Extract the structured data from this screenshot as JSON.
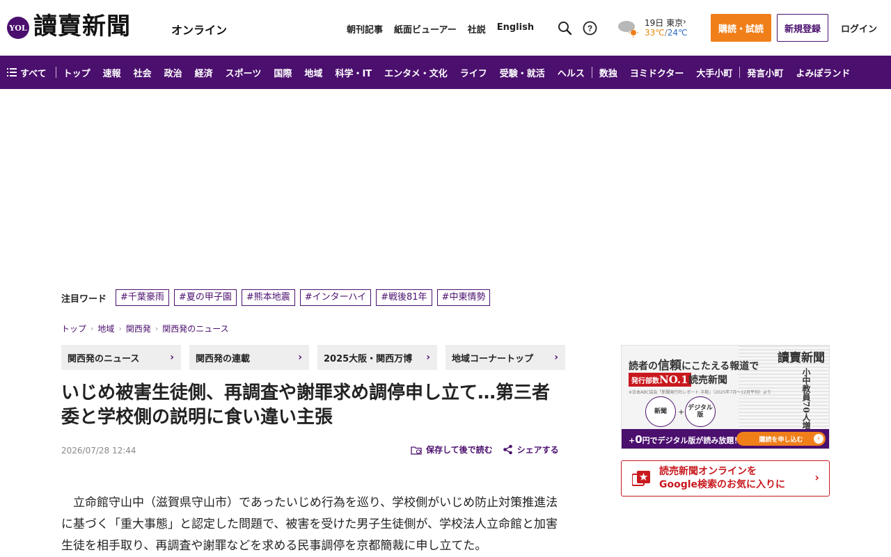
{
  "header": {
    "logo_badge": "YOL",
    "logo_title": "讀賣新聞",
    "logo_sub": "オンライン",
    "links": [
      "朝刊記事",
      "紙面ビューアー",
      "社説",
      "English"
    ],
    "weather": {
      "date": "19日 東京",
      "high": "33℃",
      "low": "24℃"
    },
    "subscribe_label": "購読・試読",
    "register_label": "新規登録",
    "login_label": "ログイン",
    "accent_color": "#4b0f6e",
    "orange_color": "#f07f1a"
  },
  "nav": {
    "all_label": "すべて",
    "items_a": [
      "トップ",
      "速報",
      "社会",
      "政治",
      "経済",
      "スポーツ",
      "国際",
      "地域",
      "科学・IT",
      "エンタメ・文化",
      "ライフ",
      "受験・就活",
      "ヘルス"
    ],
    "items_b": [
      "数独",
      "ヨミドクター",
      "大手小町"
    ],
    "items_c": [
      "発言小町",
      "よみぽランド"
    ]
  },
  "trend": {
    "label": "注目ワード",
    "tags": [
      "#千葉豪雨",
      "#夏の甲子園",
      "#熊本地震",
      "#インターハイ",
      "#戦後81年",
      "#中東情勢"
    ]
  },
  "breadcrumb": [
    "トップ",
    "地域",
    "関西発",
    "関西発のニュース"
  ],
  "subnav": [
    "関西発のニュース",
    "関西発の連載",
    "2025大阪・関西万博",
    "地域コーナートップ"
  ],
  "article": {
    "headline": "いじめ被害生徒側、再調査や謝罪求め調停申し立て…第三者委と学校側の説明に食い違い主張",
    "date": "2026/07/28 12:44",
    "save_label": "保存して後で読む",
    "share_label": "シェアする",
    "body": "立命館守山中（滋賀県守山市）であったいじめ行為を巡り、学校側がいじめ防止対策推進法に基づく「重大事態」と認定した問題で、被害を受けた男子生徒側が、学校法人立命館と加害生徒を相手取り、再調査や謝罪などを求める民事調停を京都簡裁に申し立てた。"
  },
  "sidebar": {
    "ad1": {
      "line1_prefix": "読者の",
      "line1_big": "信頼",
      "line1_suffix": "にこたえる報道で",
      "badge_prefix": "発行部数",
      "badge_big": "NO.1",
      "paper": "読売新聞",
      "note": "※日本ABC協会「新聞発行社レポート 半期」（2025年7月〜12月平均）より",
      "circle1": "新聞",
      "circle2": "デジタル版",
      "plus": "+",
      "bar_prefix": "+",
      "bar_big": "0",
      "bar_suffix": "円でデジタル版が読み放題！",
      "cta": "購読を申し込む",
      "paper_masthead": "讀賣新聞",
      "paper_headline": "小中教員70人増"
    },
    "ad2": {
      "line1": "読売新聞オンラインを",
      "line2": "Google検索のお気に入りに"
    }
  }
}
